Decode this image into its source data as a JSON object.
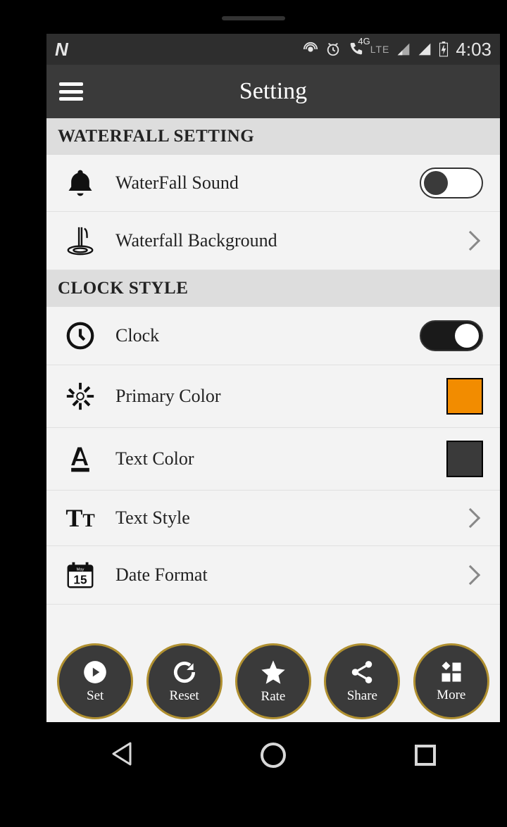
{
  "status": {
    "time": "4:03",
    "lte": "LTE",
    "fourg": "4G"
  },
  "header": {
    "title": "Setting"
  },
  "sections": {
    "waterfall": {
      "title": "WATERFALL SETTING"
    },
    "clockstyle": {
      "title": "CLOCK STYLE"
    }
  },
  "rows": {
    "sound": {
      "label": "WaterFall Sound",
      "on": false
    },
    "background": {
      "label": "Waterfall Background"
    },
    "clock": {
      "label": "Clock",
      "on": true
    },
    "primaryColor": {
      "label": "Primary Color",
      "color": "#f28c00"
    },
    "textColor": {
      "label": "Text Color",
      "color": "#3a3a3a"
    },
    "textStyle": {
      "label": "Text Style"
    },
    "dateFormat": {
      "label": "Date Format",
      "calMonth": "May",
      "calDay": "15"
    }
  },
  "bottom": {
    "set": "Set",
    "reset": "Reset",
    "rate": "Rate",
    "share": "Share",
    "more": "More"
  }
}
